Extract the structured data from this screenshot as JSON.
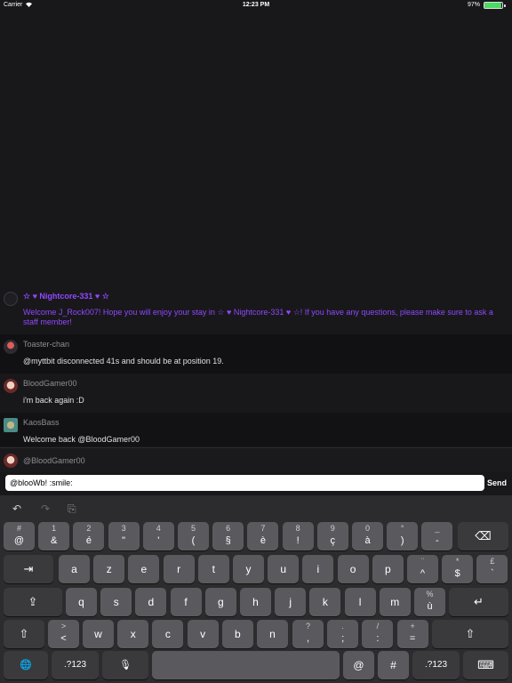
{
  "status_bar": {
    "carrier": "Carrier",
    "time": "12:23 PM",
    "battery": "97%",
    "wifi_icon": "wifi-icon",
    "battery_icon": "battery-icon",
    "battery_level": 0.97
  },
  "chat": {
    "messages": [
      {
        "name": "☆ ♥ Nightcore-331 ♥ ☆",
        "text": "Welcome J_Rock007! Hope you will enjoy your stay in ☆ ♥ Nightcore-331 ♥ ☆! If you have any questions, please make sure to ask a staff member!"
      },
      {
        "name": "Toaster-chan",
        "text": "@myttbit disconnected 41s and should be at position 19."
      },
      {
        "name": "BloodGamer00",
        "text": "i'm back again :D"
      },
      {
        "name": "KaosBass",
        "text": "Welcome back @BloodGamer00"
      }
    ],
    "mention_suggestion": "@BloodGamer00",
    "colors": {
      "system_accent": "#9147ff",
      "background": "#18181b"
    }
  },
  "input": {
    "value": "@blooWb! :smile:",
    "send_label": "Send"
  },
  "keyboard": {
    "toolbar": {
      "undo": "↶",
      "redo": "↷",
      "paste": "⎘"
    },
    "row1": [
      {
        "top": "#",
        "bot": "@"
      },
      {
        "top": "1",
        "bot": "&"
      },
      {
        "top": "2",
        "bot": "é"
      },
      {
        "top": "3",
        "bot": "\""
      },
      {
        "top": "4",
        "bot": "'"
      },
      {
        "top": "5",
        "bot": "("
      },
      {
        "top": "6",
        "bot": "§"
      },
      {
        "top": "7",
        "bot": "è"
      },
      {
        "top": "8",
        "bot": "!"
      },
      {
        "top": "9",
        "bot": "ç"
      },
      {
        "top": "0",
        "bot": "à"
      },
      {
        "top": "°",
        "bot": ")"
      },
      {
        "top": "_",
        "bot": "-"
      }
    ],
    "delete": "⌫",
    "tab": "⇥",
    "row2": [
      "a",
      "z",
      "e",
      "r",
      "t",
      "y",
      "u",
      "i",
      "o",
      "p"
    ],
    "row2_extra": [
      {
        "top": "¨",
        "bot": "^"
      },
      {
        "top": "*",
        "bot": "$"
      },
      {
        "top": "£",
        "bot": "`"
      }
    ],
    "capslock": "⇪",
    "row3": [
      "q",
      "s",
      "d",
      "f",
      "g",
      "h",
      "j",
      "k",
      "l",
      "m"
    ],
    "row3_extra": {
      "top": "%",
      "bot": "ù"
    },
    "return": "↵",
    "shift": "⇧",
    "row4_first": {
      "top": ">",
      "bot": "<"
    },
    "row4": [
      "w",
      "x",
      "c",
      "v",
      "b",
      "n"
    ],
    "row4_extra": [
      {
        "top": "?",
        "bot": ","
      },
      {
        "top": ".",
        "bot": ";"
      },
      {
        "top": "/",
        "bot": ":"
      },
      {
        "top": "+",
        "bot": "="
      }
    ],
    "globe": "🌐",
    "numbers": ".?123",
    "mic": "🎙",
    "at": "@",
    "hash": "#",
    "dismiss": "⌨"
  }
}
